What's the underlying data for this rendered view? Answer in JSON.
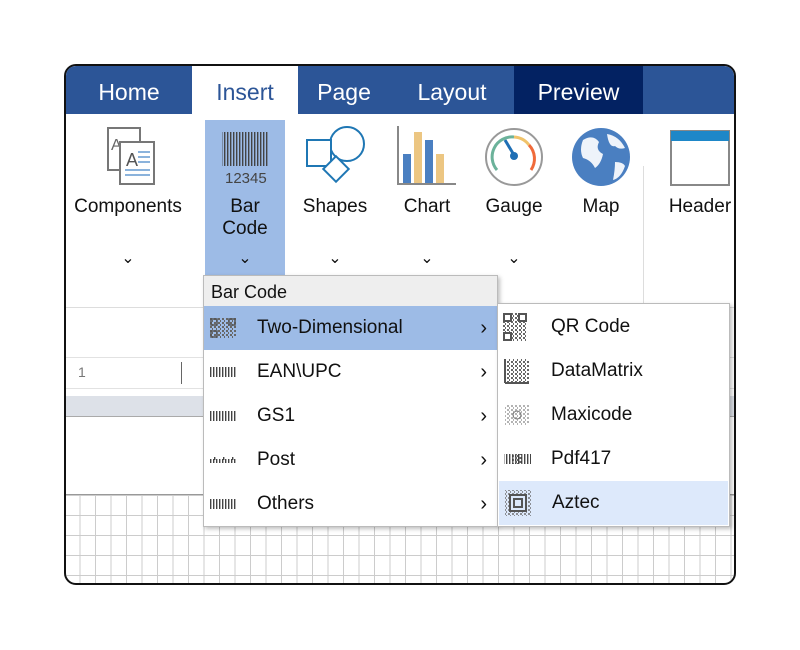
{
  "tabs": [
    {
      "label": "Home"
    },
    {
      "label": "Insert"
    },
    {
      "label": "Page"
    },
    {
      "label": "Layout"
    },
    {
      "label": "Preview"
    }
  ],
  "ribbon": {
    "components": "Components",
    "barcode_line1": "Bar",
    "barcode_line2": "Code",
    "barcode_icon_text": "12345",
    "shapes": "Shapes",
    "chart": "Chart",
    "gauge": "Gauge",
    "map": "Map",
    "header": "Header",
    "chevron": "⌄"
  },
  "document": {
    "row_value": "1"
  },
  "menu": {
    "title": "Bar Code",
    "items": [
      {
        "label": "Two-Dimensional",
        "icon": "qr-icon"
      },
      {
        "label": "EAN\\UPC",
        "icon": "barcode-icon"
      },
      {
        "label": "GS1",
        "icon": "barcode-icon"
      },
      {
        "label": "Post",
        "icon": "postal-barcode-icon"
      },
      {
        "label": "Others",
        "icon": "barcode-icon"
      }
    ],
    "arrow": "›"
  },
  "submenu": {
    "items": [
      {
        "label": "QR Code",
        "icon": "qr-icon"
      },
      {
        "label": "DataMatrix",
        "icon": "datamatrix-icon"
      },
      {
        "label": "Maxicode",
        "icon": "maxicode-icon"
      },
      {
        "label": "Pdf417",
        "icon": "pdf417-icon"
      },
      {
        "label": "Aztec",
        "icon": "aztec-icon"
      }
    ]
  },
  "colors": {
    "tabbar": "#2c5597",
    "preview_tab": "#032262",
    "selected": "#9dbbe6",
    "hover": "#dde9fb"
  }
}
